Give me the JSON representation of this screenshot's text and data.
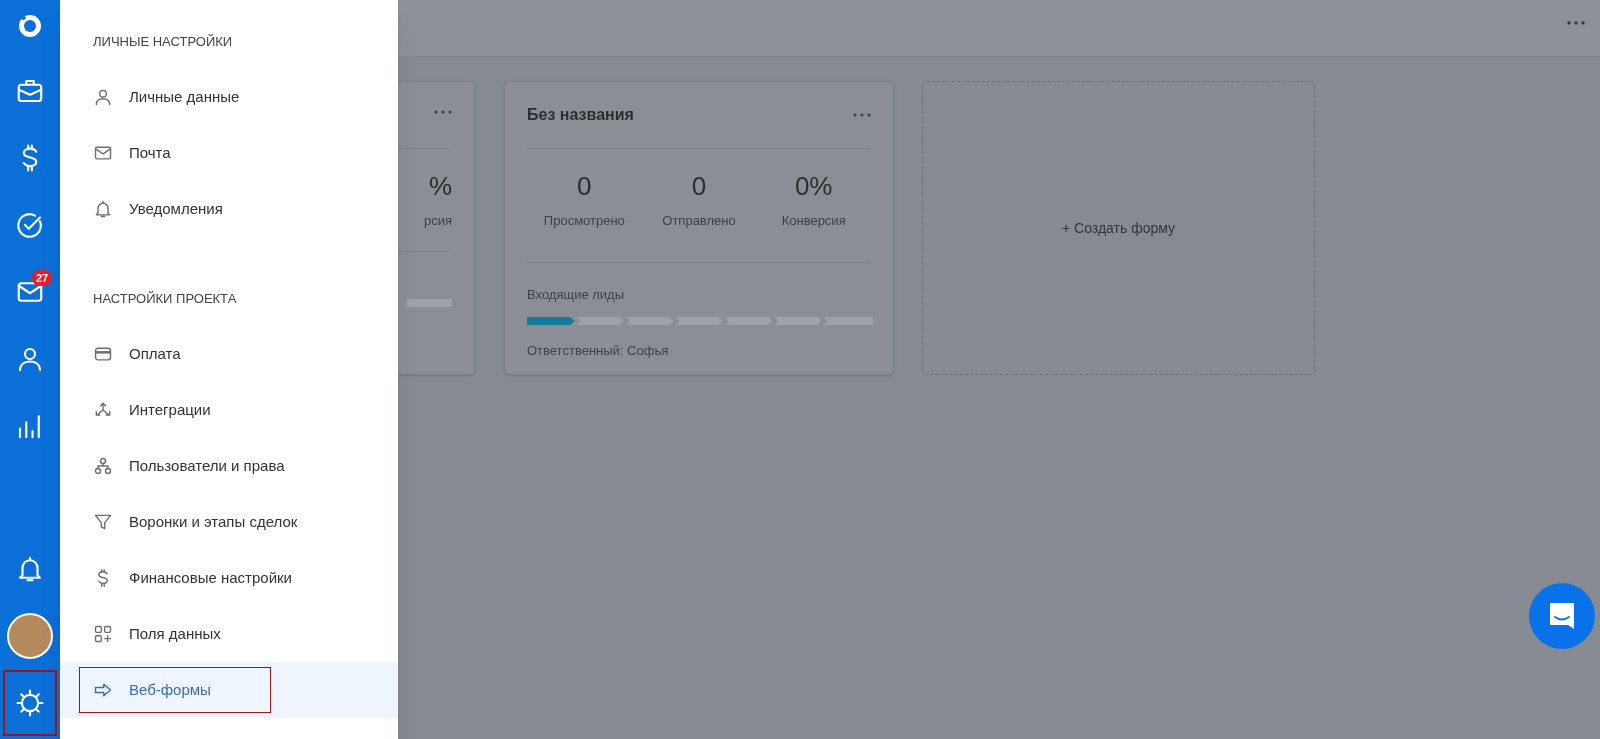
{
  "rail": {
    "top_items": [
      {
        "kind": "briefcase",
        "highlighted": false
      },
      {
        "kind": "dollar",
        "highlighted": false
      },
      {
        "kind": "check",
        "highlighted": false
      },
      {
        "kind": "mail",
        "badge": "27",
        "highlighted": false
      },
      {
        "kind": "person",
        "highlighted": false
      },
      {
        "kind": "chart",
        "highlighted": false
      }
    ],
    "bottom_items": [
      {
        "kind": "bell",
        "highlighted": false
      },
      {
        "kind": "avatar",
        "highlighted": false
      },
      {
        "kind": "gear",
        "highlighted": true
      }
    ]
  },
  "settings_menu": {
    "sections": [
      {
        "title": "ЛИЧНЫЕ НАСТРОЙКИ",
        "items": [
          {
            "kind": "person",
            "label": "Личные данные",
            "selected": false,
            "highlighted": false
          },
          {
            "kind": "mail",
            "label": "Почта",
            "selected": false,
            "highlighted": false
          },
          {
            "kind": "bell",
            "label": "Уведомления",
            "selected": false,
            "highlighted": false
          }
        ]
      },
      {
        "title": "НАСТРОЙКИ ПРОЕКТА",
        "items": [
          {
            "kind": "card",
            "label": "Оплата",
            "selected": false,
            "highlighted": false
          },
          {
            "kind": "arrows",
            "label": "Интеграции",
            "selected": false,
            "highlighted": false
          },
          {
            "kind": "users",
            "label": "Пользователи и права",
            "selected": false,
            "highlighted": false
          },
          {
            "kind": "funnel",
            "label": "Воронки и этапы сделок",
            "selected": false,
            "highlighted": false
          },
          {
            "kind": "dollar",
            "label": "Финансовые настройки",
            "selected": false,
            "highlighted": false
          },
          {
            "kind": "grid",
            "label": "Поля данных",
            "selected": false,
            "highlighted": false
          },
          {
            "kind": "arrow",
            "label": "Веб-формы",
            "selected": true,
            "highlighted": true
          }
        ]
      }
    ]
  },
  "cards": [
    {
      "kind": "partial",
      "stat_value": "%",
      "stat_label": "рсия"
    },
    {
      "kind": "form",
      "title": "Без названия",
      "stats": [
        {
          "value": "0",
          "label": "Просмотрено"
        },
        {
          "value": "0",
          "label": "Отправлено"
        },
        {
          "value": "0%",
          "label": "Конверсия"
        }
      ],
      "funnel_label": "Входящие лиды",
      "stages": [
        {
          "filled": true
        },
        {
          "filled": false
        },
        {
          "filled": false
        },
        {
          "filled": false
        },
        {
          "filled": false
        },
        {
          "filled": false
        },
        {
          "filled": false
        }
      ],
      "owner": "Ответственный: Софья"
    },
    {
      "kind": "create",
      "label": "+ Создать форму"
    }
  ]
}
